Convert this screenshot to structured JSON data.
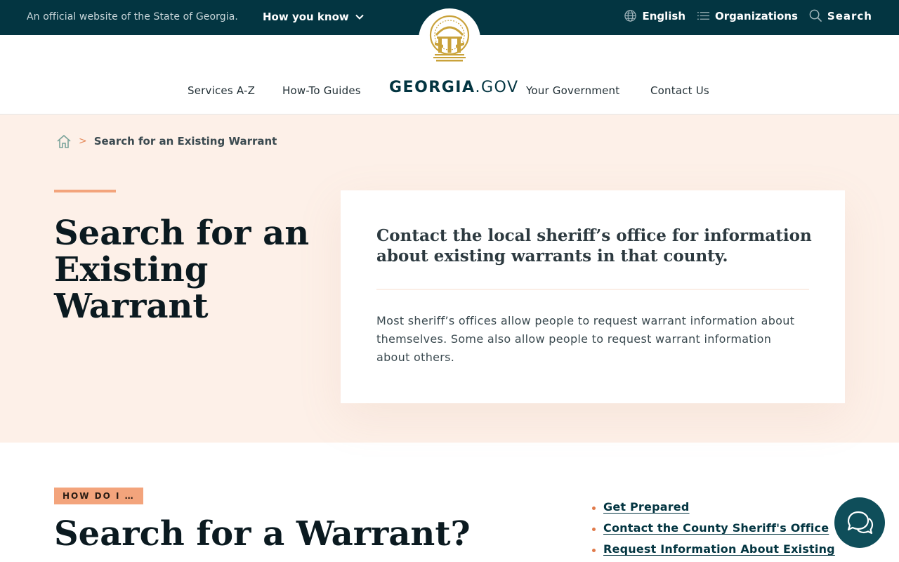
{
  "topbar": {
    "official_text": "An official website of the State of Georgia.",
    "how_you_know": "How you know",
    "language": "English",
    "organizations": "Organizations",
    "search": "Search"
  },
  "header": {
    "brand_bold": "GEORGIA",
    "brand_light": ".GOV",
    "nav": [
      "Services A-Z",
      "How-To Guides",
      "Your Government",
      "Contact Us"
    ]
  },
  "breadcrumb": {
    "current": "Search for an Existing Warrant",
    "separator": ">"
  },
  "hero": {
    "title": "Search for an Existing Warrant",
    "card_lead": "Contact the local sheriff’s office for information about existing warrants in that county.",
    "card_body": "Most sheriff’s offices allow people to request warrant information about themselves. Some also allow people to request warrant information about others."
  },
  "section": {
    "badge": "HOW DO I …",
    "title": "Search for a Warrant?",
    "toc": [
      "Get Prepared",
      "Contact the County Sheriff's Office",
      "Request Information About Existing"
    ]
  },
  "icons": {
    "seal": "georgia-seal-icon",
    "language": "globe-icon",
    "organizations": "list-icon",
    "search": "search-icon",
    "home": "home-icon",
    "chat": "chat-bubbles-icon",
    "chevron": "chevron-down-icon"
  },
  "colors": {
    "topbar_bg": "#033541",
    "hero_bg": "#fdf0e8",
    "accent": "#f3a47c",
    "seal_gold": "#c9a23a",
    "chat_bg": "#0f4e5a"
  }
}
